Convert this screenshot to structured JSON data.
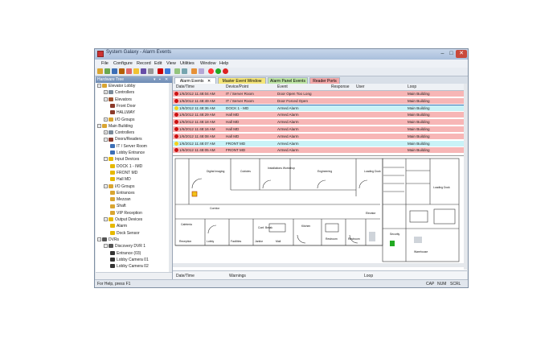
{
  "window": {
    "title": "System Galaxy - Alarm Events",
    "min": "–",
    "max": "□",
    "close": "✕"
  },
  "menu": [
    "File",
    "Configure",
    "Record",
    "Edit",
    "View",
    "Utilities",
    "Window",
    "Help"
  ],
  "sidebar": {
    "title": "Hardware Tree",
    "head_icons": [
      "▾",
      "▪",
      "✕"
    ],
    "items": [
      {
        "label": "Elevator Lobby",
        "level": 0,
        "toggle": "−",
        "icon": "folder"
      },
      {
        "label": "Controllers",
        "level": 1,
        "toggle": "+",
        "icon": "controller"
      },
      {
        "label": "Elevators",
        "level": 1,
        "toggle": "−",
        "icon": "elevator"
      },
      {
        "label": "Front Door",
        "level": 2,
        "toggle": "",
        "icon": "door"
      },
      {
        "label": "HALLWAY",
        "level": 2,
        "toggle": "",
        "icon": "door"
      },
      {
        "label": "I/O Groups",
        "level": 1,
        "toggle": "+",
        "icon": "io"
      },
      {
        "label": "Main Building",
        "level": 0,
        "toggle": "−",
        "icon": "folder"
      },
      {
        "label": "Controllers",
        "level": 1,
        "toggle": "+",
        "icon": "controller"
      },
      {
        "label": "Doors/Readers",
        "level": 1,
        "toggle": "−",
        "icon": "door"
      },
      {
        "label": "IT / Server Room",
        "level": 2,
        "toggle": "",
        "icon": "reader"
      },
      {
        "label": "Lobby Entrance",
        "level": 2,
        "toggle": "",
        "icon": "reader"
      },
      {
        "label": "Input Devices",
        "level": 1,
        "toggle": "−",
        "icon": "warning"
      },
      {
        "label": "DOCK 1 - IMD",
        "level": 2,
        "toggle": "",
        "icon": "warning"
      },
      {
        "label": "FRONT MD",
        "level": 2,
        "toggle": "",
        "icon": "warning"
      },
      {
        "label": "Hall MD",
        "level": 2,
        "toggle": "",
        "icon": "warning"
      },
      {
        "label": "I/O Groups",
        "level": 1,
        "toggle": "−",
        "icon": "io"
      },
      {
        "label": "Entrances",
        "level": 2,
        "toggle": "",
        "icon": "io"
      },
      {
        "label": "Mezzan",
        "level": 2,
        "toggle": "",
        "icon": "io"
      },
      {
        "label": "Shaft",
        "level": 2,
        "toggle": "",
        "icon": "io"
      },
      {
        "label": "VIP Reception",
        "level": 2,
        "toggle": "",
        "icon": "io"
      },
      {
        "label": "Output Devices",
        "level": 1,
        "toggle": "−",
        "icon": "output"
      },
      {
        "label": "Alarm",
        "level": 2,
        "toggle": "",
        "icon": "output"
      },
      {
        "label": "Dock Sensor",
        "level": 2,
        "toggle": "",
        "icon": "output"
      },
      {
        "label": "DVRs",
        "level": 0,
        "toggle": "−",
        "icon": "dvr"
      },
      {
        "label": "Discovery DVR 1",
        "level": 1,
        "toggle": "−",
        "icon": "dvr"
      },
      {
        "label": "Entrance (03)",
        "level": 2,
        "toggle": "",
        "icon": "camera"
      },
      {
        "label": "Lobby Camera 01",
        "level": 2,
        "toggle": "",
        "icon": "camera"
      },
      {
        "label": "Lobby Camera 02",
        "level": 2,
        "toggle": "",
        "icon": "camera"
      }
    ]
  },
  "tabs": [
    {
      "label": "Alarm Events",
      "close": "✕",
      "color": "#ffffff"
    },
    {
      "label": "Master Event Window",
      "close": "",
      "color": "#f5e67a"
    },
    {
      "label": "Alarm Panel Events",
      "close": "",
      "color": "#bfe6a6"
    },
    {
      "label": "Reader Ports",
      "close": "",
      "color": "#f2a7a7"
    }
  ],
  "grid": {
    "columns": [
      "Date/Time",
      "Device/Point",
      "Event",
      "Response",
      "User",
      "Loop"
    ],
    "rows": [
      {
        "datetime": "1/6/2012 11:48:04 AM",
        "device": "IT / Server Room",
        "event": "Door Open Too Long",
        "response": "",
        "user": "",
        "loop": "Main Building",
        "bg": "#f7b6b6",
        "dot": "#cc1111"
      },
      {
        "datetime": "1/6/2012 11:48:49 AM",
        "device": "IT / Server Room",
        "event": "Door Forced Open",
        "response": "",
        "user": "",
        "loop": "Main Building",
        "bg": "#f7b6b6",
        "dot": "#cc1111"
      },
      {
        "datetime": "1/6/2012 11:48:36 AM",
        "device": "DOCK 1 - MD",
        "event": "Armed Alarm",
        "response": "",
        "user": "",
        "loop": "Main Building",
        "bg": "#c9f2f7",
        "dot": "#f2d21a"
      },
      {
        "datetime": "1/6/2012 11:48:29 AM",
        "device": "Hall MD",
        "event": "Armed Alarm",
        "response": "",
        "user": "",
        "loop": "Main Building",
        "bg": "#f7b6b6",
        "dot": "#cc1111"
      },
      {
        "datetime": "1/6/2012 11:48:18 AM",
        "device": "Hall MD",
        "event": "Armed Alarm",
        "response": "",
        "user": "",
        "loop": "Main Building",
        "bg": "#f7b6b6",
        "dot": "#cc1111"
      },
      {
        "datetime": "1/6/2012 11:48:16 AM",
        "device": "Hall MD",
        "event": "Armed Alarm",
        "response": "",
        "user": "",
        "loop": "Main Building",
        "bg": "#f7b6b6",
        "dot": "#cc1111"
      },
      {
        "datetime": "1/6/2012 11:48:08 AM",
        "device": "Hall MD",
        "event": "Armed Alarm",
        "response": "",
        "user": "",
        "loop": "Main Building",
        "bg": "#f7b6b6",
        "dot": "#cc1111"
      },
      {
        "datetime": "1/6/2012 11:48:07 AM",
        "device": "FRONT MD",
        "event": "Armed Alarm",
        "response": "",
        "user": "",
        "loop": "Main Building",
        "bg": "#c9f2f7",
        "dot": "#f2d21a"
      },
      {
        "datetime": "1/6/2012 11:48:05 AM",
        "device": "FRONT MD",
        "event": "Armed Alarm",
        "response": "",
        "user": "",
        "loop": "Main Building",
        "bg": "#f7b6b6",
        "dot": "#cc1111"
      }
    ]
  },
  "floorplan": {
    "labels": [
      "Digital Imaging",
      "Cubicles",
      "Installations Workshop",
      "Engineering",
      "Loading Dock",
      "Loading Dock",
      "Corridor",
      "Cafeteria",
      "Conf. Break",
      "Kitchen",
      "Facilities",
      "Warehouse",
      "Security",
      "Restroom",
      "Restroom",
      "Lobby",
      "Janitor",
      "Mail",
      "Reception",
      "Elevator"
    ]
  },
  "bottom": {
    "columns": [
      "Date/Time",
      "Warnings",
      "Loop"
    ]
  },
  "status": {
    "left": "For Help, press F1",
    "right": [
      "CAP",
      "NUM",
      "SCRL"
    ]
  },
  "colors": {
    "alarm_red": "#f7b6b6",
    "alarm_cyan": "#c9f2f7",
    "title_blue": "#a9bfdc"
  }
}
